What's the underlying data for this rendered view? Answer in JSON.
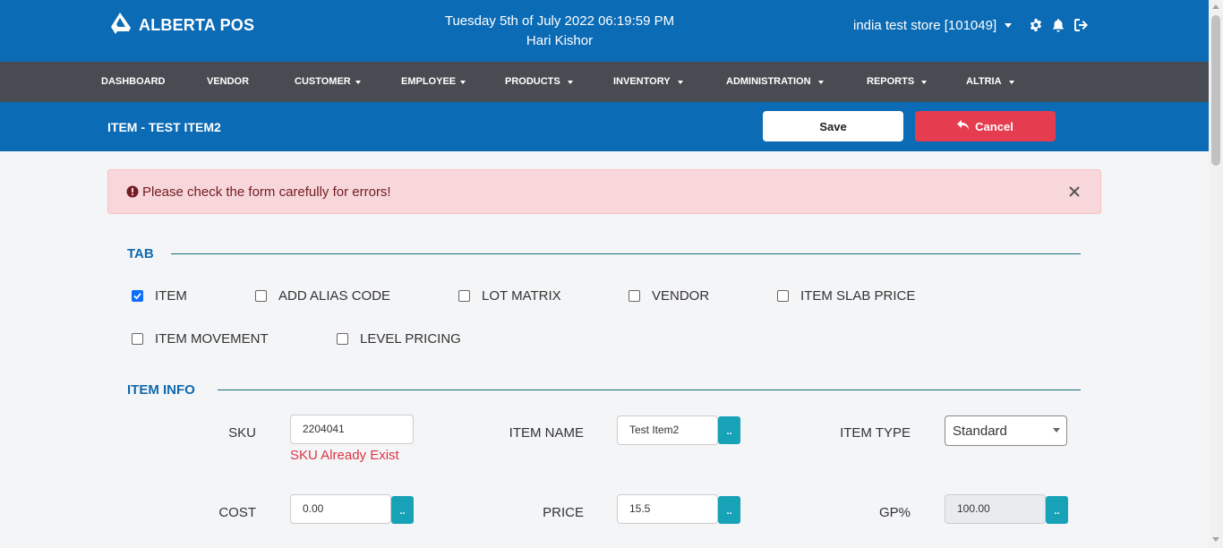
{
  "header": {
    "brand": "ALBERTA POS",
    "datetime": "Tuesday 5th of July 2022 06:19:59 PM",
    "user": "Hari Kishor",
    "store": "india test store [101049]"
  },
  "icons": {
    "logo": "alberta-logo-icon",
    "settings": "gear-icon",
    "notifications": "bell-icon",
    "logout": "logout-icon",
    "cancel": "undo-arrow-icon",
    "alert": "exclamation-circle-icon",
    "close": "close-icon"
  },
  "nav": [
    {
      "label": "DASHBOARD",
      "dropdown": false
    },
    {
      "label": "VENDOR",
      "dropdown": false
    },
    {
      "label": "CUSTOMER",
      "dropdown": true
    },
    {
      "label": "EMPLOYEE",
      "dropdown": true
    },
    {
      "label": "PRODUCTS",
      "dropdown": true
    },
    {
      "label": "INVENTORY",
      "dropdown": true
    },
    {
      "label": "ADMINISTRATION",
      "dropdown": true
    },
    {
      "label": "REPORTS",
      "dropdown": true
    },
    {
      "label": "ALTRIA",
      "dropdown": true
    }
  ],
  "page": {
    "title": "ITEM - TEST ITEM2",
    "save_label": "Save",
    "cancel_label": "Cancel"
  },
  "alert": {
    "message": "Please check the form carefully for errors!"
  },
  "tab_section": {
    "title": "TAB",
    "options": [
      {
        "label": "ITEM",
        "checked": true
      },
      {
        "label": "ADD ALIAS CODE",
        "checked": false
      },
      {
        "label": "LOT MATRIX",
        "checked": false
      },
      {
        "label": "VENDOR",
        "checked": false
      },
      {
        "label": "ITEM SLAB PRICE",
        "checked": false
      },
      {
        "label": "ITEM MOVEMENT",
        "checked": false
      },
      {
        "label": "LEVEL PRICING",
        "checked": false
      }
    ]
  },
  "item_info": {
    "title": "ITEM INFO",
    "sku": {
      "label": "SKU",
      "value": "2204041",
      "error": "SKU Already Exist"
    },
    "item_name": {
      "label": "ITEM NAME",
      "value": "Test Item2",
      "button": ".."
    },
    "item_type": {
      "label": "ITEM TYPE",
      "value": "Standard"
    },
    "cost": {
      "label": "COST",
      "value": "0.00",
      "button": ".."
    },
    "price": {
      "label": "PRICE",
      "value": "15.5",
      "button": ".."
    },
    "gp": {
      "label": "GP%",
      "value": "100.00",
      "button": ".."
    }
  },
  "colors": {
    "primary": "#0b6bb5",
    "nav": "#484c52",
    "danger": "#e63c4f",
    "info": "#17a2b8",
    "alert_bg": "#f8d7da"
  }
}
